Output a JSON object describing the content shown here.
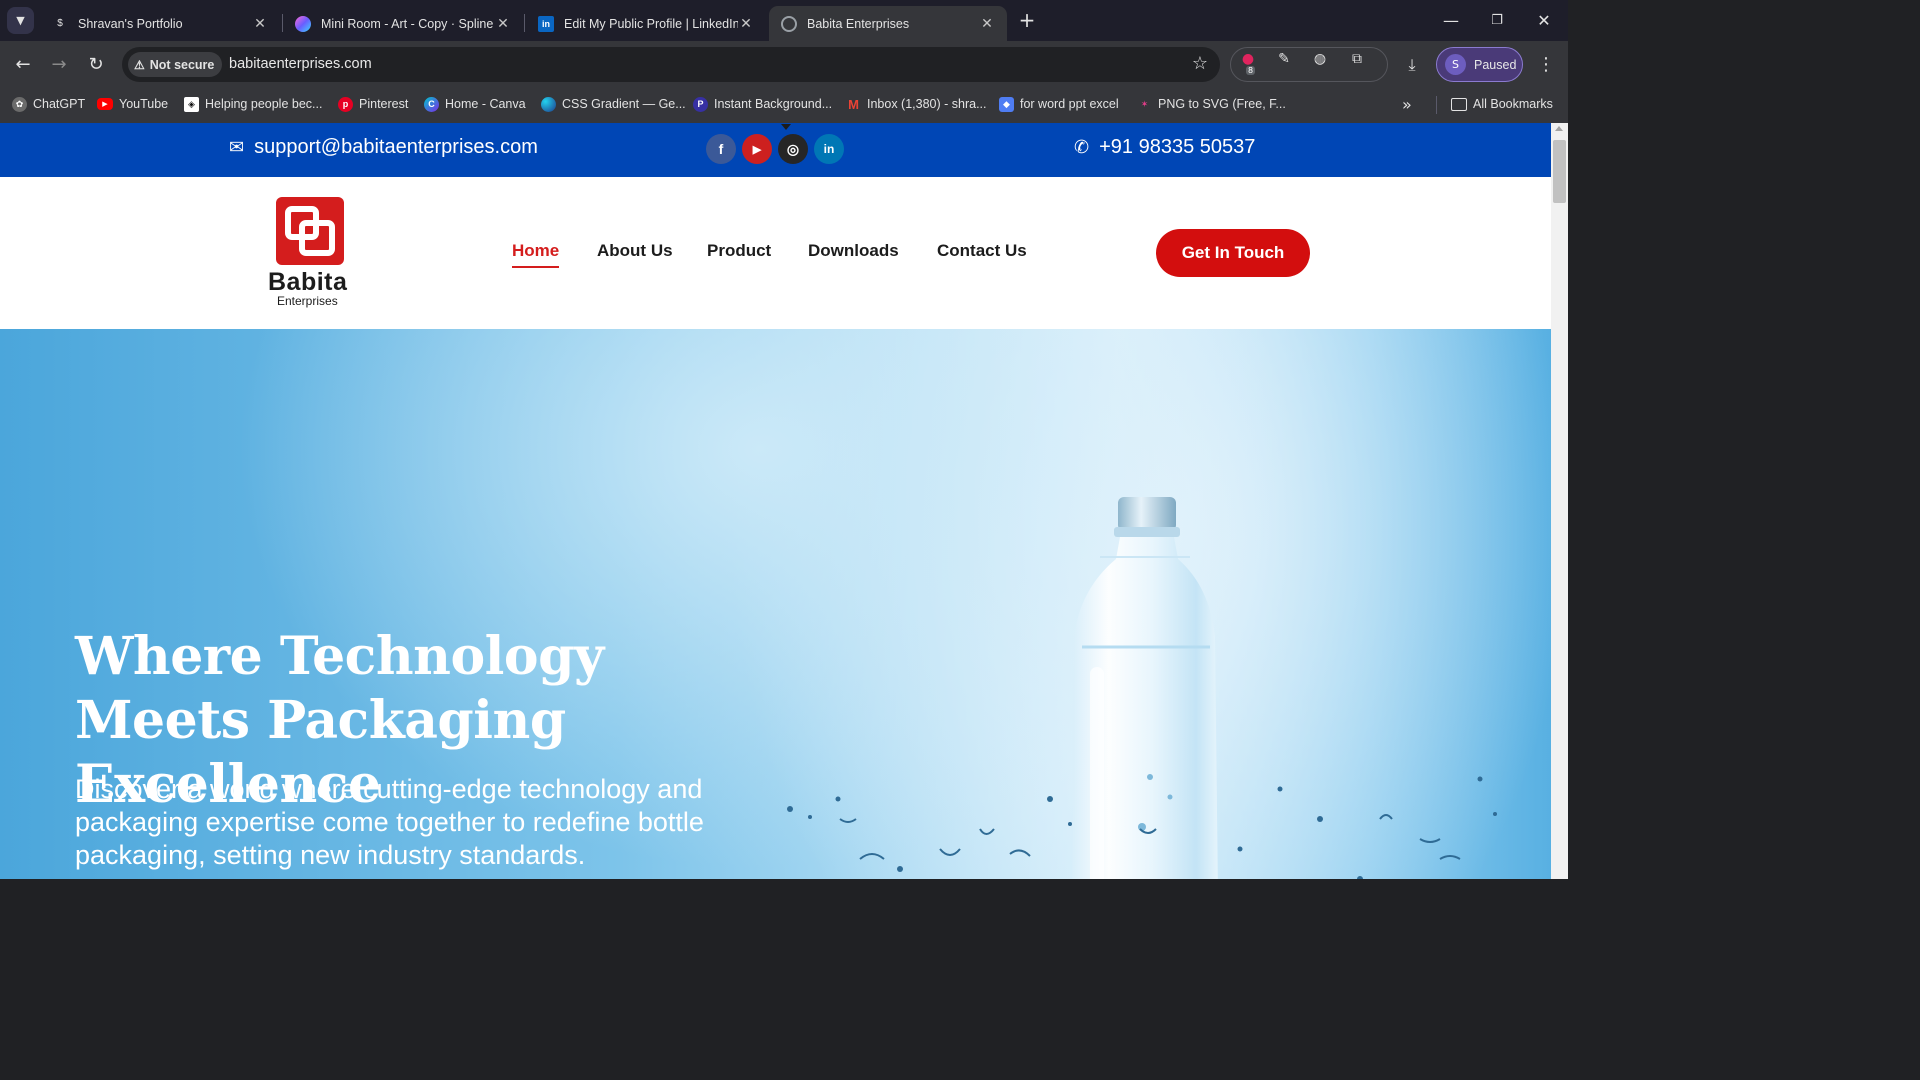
{
  "browser": {
    "tabs": [
      {
        "title": "Shravan's Portfolio",
        "favicon": "dollar-icon",
        "active": false
      },
      {
        "title": "Mini Room - Art - Copy · Spline",
        "favicon": "spline-icon",
        "active": false
      },
      {
        "title": "Edit My Public Profile | LinkedIn",
        "favicon": "linkedin-icon",
        "active": false
      },
      {
        "title": "Babita Enterprises",
        "favicon": "globe-icon",
        "active": true
      }
    ],
    "security_label": "Not secure",
    "url": "babitaenterprises.com",
    "extension_badge": "8",
    "profile_initial": "S",
    "profile_status": "Paused",
    "bookmarks": [
      {
        "label": "ChatGPT",
        "icon": "chatgpt-icon",
        "color": "#6b6b6b"
      },
      {
        "label": "YouTube",
        "icon": "youtube-icon",
        "color": "#ff0000"
      },
      {
        "label": "Helping people bec...",
        "icon": "codecademy-icon",
        "color": "#ffffff"
      },
      {
        "label": "Pinterest",
        "icon": "pinterest-icon",
        "color": "#e60023"
      },
      {
        "label": "Home - Canva",
        "icon": "canva-icon",
        "color": "#3b82f6"
      },
      {
        "label": "CSS Gradient — Ge...",
        "icon": "cssgradient-icon",
        "color": "#2563eb"
      },
      {
        "label": "Instant Background...",
        "icon": "removebg-icon",
        "color": "#3730a3"
      },
      {
        "label": "Inbox (1,380) - shra...",
        "icon": "gmail-icon",
        "color": "#ea4335"
      },
      {
        "label": "for word ppt excel",
        "icon": "shield-icon",
        "color": "#4f7df3"
      },
      {
        "label": "PNG to SVG (Free, F...",
        "icon": "pngtosvg-icon",
        "color": "#e83e8c"
      }
    ],
    "all_bookmarks_label": "All Bookmarks"
  },
  "site": {
    "topbar": {
      "email": "support@babitaenterprises.com",
      "phone": "+91 98335 50537",
      "social": [
        {
          "name": "facebook-icon",
          "glyph": "f",
          "color": "#3b5998"
        },
        {
          "name": "youtube-icon",
          "glyph": "▶",
          "color": "#cd201f"
        },
        {
          "name": "instagram-icon",
          "glyph": "◎",
          "color": "#262626"
        },
        {
          "name": "linkedin-icon",
          "glyph": "in",
          "color": "#0077b5"
        }
      ]
    },
    "logo": {
      "name": "Babita",
      "sub": "Enterprises"
    },
    "nav": [
      "Home",
      "About Us",
      "Product",
      "Downloads",
      "Contact Us"
    ],
    "cta_label": "Get In Touch",
    "hero": {
      "title": "Where Technology Meets Packaging Excellence",
      "description": "Discover a world where cutting-edge technology and packaging expertise come together to redefine bottle packaging, setting new industry standards."
    },
    "colors": {
      "brand_blue": "#0046b5",
      "brand_red": "#d41d1d"
    }
  }
}
